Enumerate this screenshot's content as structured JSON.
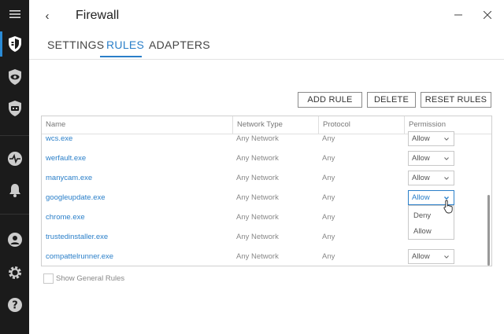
{
  "sidebar": {
    "items": [
      {
        "icon": "menu-icon"
      },
      {
        "icon": "firewall-shield-icon",
        "active": true
      },
      {
        "icon": "privacy-eye-shield-icon"
      },
      {
        "icon": "shield-icon"
      },
      {
        "icon": "activity-icon"
      },
      {
        "icon": "bell-icon"
      },
      {
        "icon": "user-icon"
      },
      {
        "icon": "gear-icon"
      },
      {
        "icon": "help-icon"
      }
    ],
    "accent": "#2a8bd6"
  },
  "header": {
    "back_glyph": "‹",
    "title": "Firewall"
  },
  "tabs": [
    {
      "label": "SETTINGS",
      "active": false
    },
    {
      "label": "RULES",
      "active": true
    },
    {
      "label": "ADAPTERS",
      "active": false
    }
  ],
  "toolbar": {
    "add_rule": "ADD RULE",
    "delete": "DELETE",
    "reset_rules": "RESET RULES"
  },
  "table": {
    "columns": [
      "Name",
      "Network Type",
      "Protocol",
      "Permission"
    ],
    "rows": [
      {
        "name": "wcs.exe",
        "network": "Any Network",
        "protocol": "Any",
        "permission": "Allow"
      },
      {
        "name": "werfault.exe",
        "network": "Any Network",
        "protocol": "Any",
        "permission": "Allow"
      },
      {
        "name": "manycam.exe",
        "network": "Any Network",
        "protocol": "Any",
        "permission": "Allow"
      },
      {
        "name": "googleupdate.exe",
        "network": "Any Network",
        "protocol": "Any",
        "permission": "Allow"
      },
      {
        "name": "chrome.exe",
        "network": "Any Network",
        "protocol": "Any",
        "permission": ""
      },
      {
        "name": "trustedinstaller.exe",
        "network": "Any Network",
        "protocol": "Any",
        "permission": ""
      },
      {
        "name": "compattelrunner.exe",
        "network": "Any Network",
        "protocol": "Any",
        "permission": "Allow"
      }
    ],
    "open_dropdown": {
      "row": 3,
      "options": [
        "Deny",
        "Allow"
      ]
    }
  },
  "footer": {
    "show_general_rules": "Show General Rules",
    "checked": false
  },
  "colors": {
    "accent": "#2a7fc9",
    "sidebar_bg": "#1b1b1b"
  }
}
